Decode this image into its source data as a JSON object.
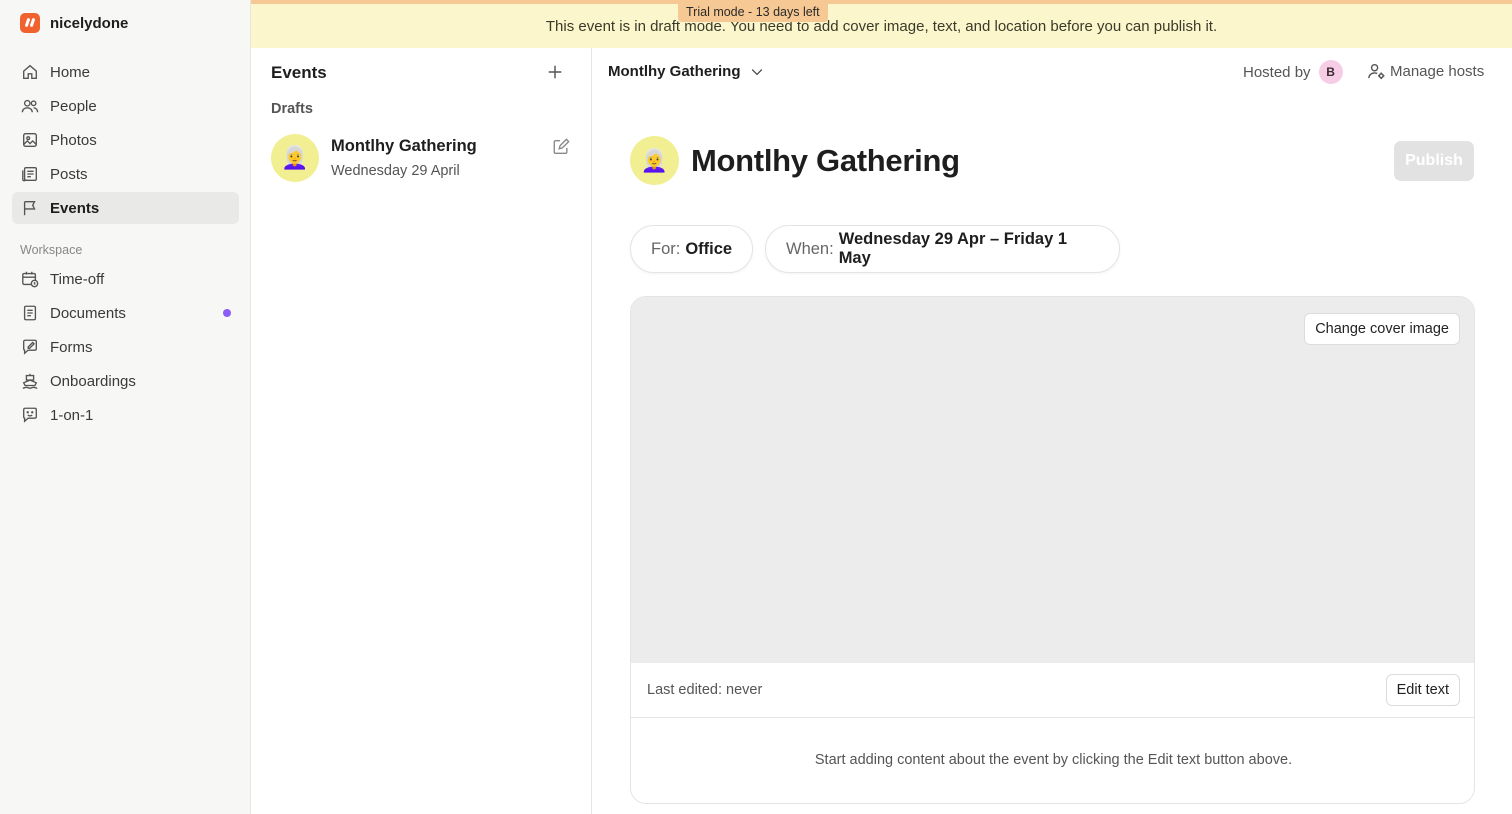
{
  "app": {
    "name": "nicelydone"
  },
  "banner": {
    "trial": "Trial mode - 13 days left",
    "message": "This event is in draft mode. You need to add cover image, text, and location before you can publish it."
  },
  "sidebar": {
    "items": [
      {
        "label": "Home",
        "icon": "home-icon"
      },
      {
        "label": "People",
        "icon": "people-icon"
      },
      {
        "label": "Photos",
        "icon": "photo-icon"
      },
      {
        "label": "Posts",
        "icon": "posts-icon"
      },
      {
        "label": "Events",
        "icon": "flag-icon",
        "active": true
      }
    ],
    "workspace_label": "Workspace",
    "workspace_items": [
      {
        "label": "Time-off",
        "icon": "calendar-clock-icon"
      },
      {
        "label": "Documents",
        "icon": "document-icon",
        "badge_color": "#8b5cf6"
      },
      {
        "label": "Forms",
        "icon": "form-icon"
      },
      {
        "label": "Onboardings",
        "icon": "boat-icon"
      },
      {
        "label": "1-on-1",
        "icon": "chat-face-icon"
      }
    ]
  },
  "events_panel": {
    "title": "Events",
    "section": "Drafts",
    "items": [
      {
        "name": "Montlhy Gathering",
        "date": "Wednesday 29 April",
        "emoji": "👩‍🦳"
      }
    ]
  },
  "main": {
    "selector_label": "Montlhy Gathering",
    "hosted_by": "Hosted by",
    "host_initial": "B",
    "manage_hosts": "Manage hosts",
    "title": "Montlhy Gathering",
    "emoji": "👩‍🦳",
    "publish": "Publish",
    "for_label": "For:",
    "for_value": "Office",
    "when_label": "When:",
    "when_value": "Wednesday 29 Apr – Friday 1 May",
    "change_cover": "Change cover image",
    "last_edited": "Last edited: never",
    "edit_text": "Edit text",
    "hint": "Start adding content about the event by clicking the Edit text button above."
  }
}
